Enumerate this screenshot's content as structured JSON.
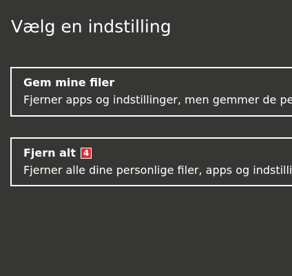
{
  "page": {
    "title": "Vælg en indstilling"
  },
  "options": [
    {
      "title": "Gem mine filer",
      "description": "Fjerner apps og indstillinger, men gemmer de personlige filer."
    },
    {
      "title": "Fjern alt",
      "badge": "4",
      "description": "Fjerner alle dine personlige filer, apps og indstillinger."
    }
  ],
  "colors": {
    "background": "#363735",
    "text": "#ffffff",
    "badge": "#e02a2f"
  }
}
